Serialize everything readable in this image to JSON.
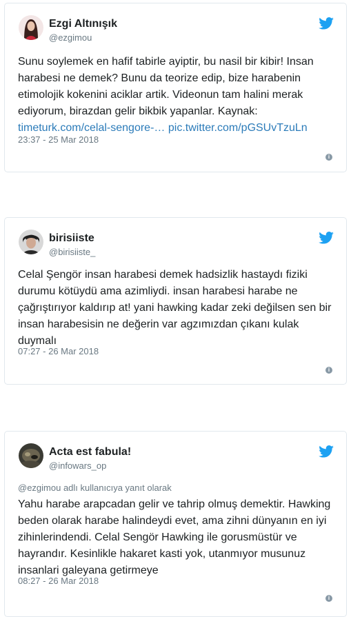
{
  "tweets": [
    {
      "name": "Ezgi Altınışık",
      "handle": "@ezgimou",
      "text": "Sunu soylemek en hafif tabirle ayiptir, bu nasil bir kibir! Insan harabesi ne demek? Bunu da teorize edip, bize harabenin etimolojik kokenini aciklar artik. Videonun tam halini merak ediyorum, birazdan gelir bikbik yapanlar. Kaynak: ",
      "link1": "timeturk.com/celal-sengore-…",
      "link2": "pic.twitter.com/pGSUvTzuLn",
      "time": "23:37 - 25 Mar 2018"
    },
    {
      "name": "birisiiste",
      "handle": "@birisiiste_",
      "text": "Celal Şengör insan harabesi demek hadsizlik hastaydı fiziki durumu kötüydü ama azimliydi. insan harabesi harabe ne çağrıştırıyor kaldırıp at! yani hawking kadar zeki değilsen sen bir insan harabesisin ne değerin var agzımızdan çıkanı kulak duymalı",
      "time": "07:27 - 26 Mar 2018"
    },
    {
      "name": "Acta est fabula!",
      "handle": "@infowars_op",
      "reply_to": "@ezgimou adlı kullanıcıya yanıt olarak",
      "text": "Yahu harabe arapcadan gelir ve tahrip olmuş demektir. Hawking beden olarak harabe halindeydi evet, ama zihni dünyanın en iyi zihinlerindendi. Celal Sengör Hawking ile gorusmüstür ve hayrandır. Kesinlikle hakaret kasti yok, utanmıyor musunuz insanlari galeyana getirmeye",
      "time": "08:27 - 26 Mar 2018"
    }
  ],
  "icons": {
    "brand": "twitter-bird-icon",
    "info": "info-icon"
  },
  "colors": {
    "link": "#2b7bb9",
    "brand": "#1da1f2",
    "muted": "#697882"
  }
}
